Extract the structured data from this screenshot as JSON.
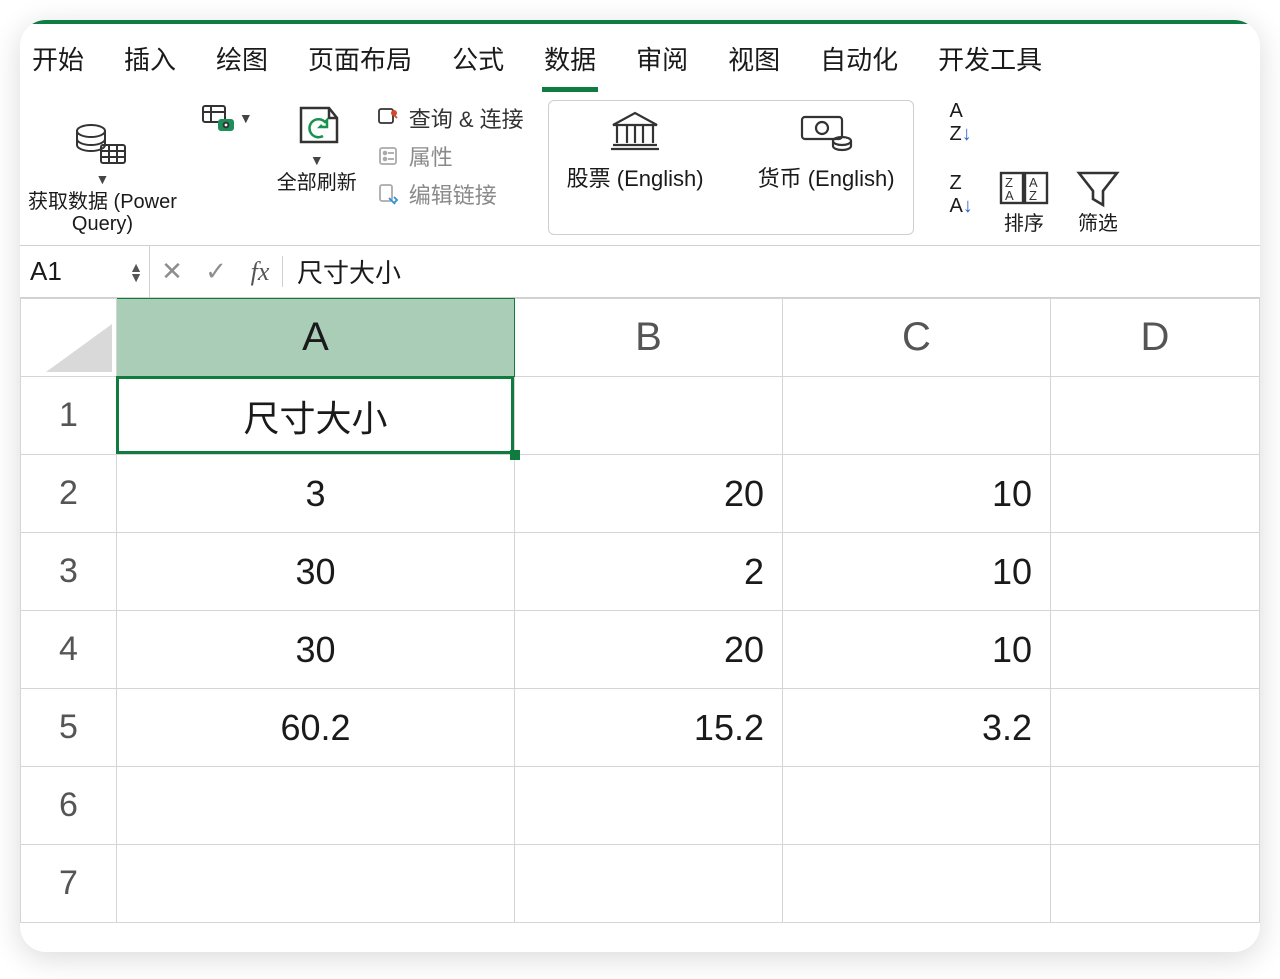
{
  "tabs": {
    "items": [
      "开始",
      "插入",
      "绘图",
      "页面布局",
      "公式",
      "数据",
      "审阅",
      "视图",
      "自动化",
      "开发工具"
    ],
    "active_index": 5
  },
  "ribbon": {
    "get_data_label": "获取数据 (Power\nQuery)",
    "refresh_all_label": "全部刷新",
    "conn": {
      "queries_label": "查询 & 连接",
      "properties_label": "属性",
      "edit_links_label": "编辑链接"
    },
    "datatype": {
      "stocks_label": "股票 (English)",
      "currency_label": "货币 (English)"
    },
    "sort": {
      "sort_label": "排序",
      "filter_label": "筛选"
    }
  },
  "formula_bar": {
    "name_box": "A1",
    "fx_label": "fx",
    "cell_value": "尺寸大小"
  },
  "grid": {
    "columns": [
      "A",
      "B",
      "C",
      "D"
    ],
    "selected_column_index": 0,
    "selected_cell": "A1",
    "rows": [
      {
        "n": 1,
        "A": "尺寸大小",
        "B": "",
        "C": "",
        "D": ""
      },
      {
        "n": 2,
        "A": "3",
        "B": "20",
        "C": "10",
        "D": ""
      },
      {
        "n": 3,
        "A": "30",
        "B": "2",
        "C": "10",
        "D": ""
      },
      {
        "n": 4,
        "A": "30",
        "B": "20",
        "C": "10",
        "D": ""
      },
      {
        "n": 5,
        "A": "60.2",
        "B": "15.2",
        "C": "3.2",
        "D": ""
      },
      {
        "n": 6,
        "A": "",
        "B": "",
        "C": "",
        "D": ""
      },
      {
        "n": 7,
        "A": "",
        "B": "",
        "C": "",
        "D": ""
      }
    ]
  },
  "chart_data": {
    "type": "table",
    "columns": [
      "A",
      "B",
      "C"
    ],
    "header_row": [
      "尺寸大小",
      "",
      ""
    ],
    "values": [
      [
        3,
        20,
        10
      ],
      [
        30,
        2,
        10
      ],
      [
        30,
        20,
        10
      ],
      [
        60.2,
        15.2,
        3.2
      ]
    ]
  }
}
